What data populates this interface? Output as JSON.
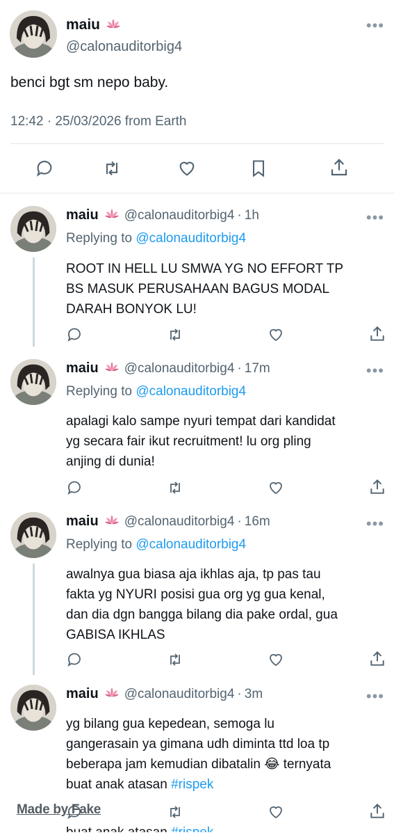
{
  "main_tweet": {
    "display_name": "maiu",
    "handle": "@calonauditorbig4",
    "text": "benci bgt sm nepo baby.",
    "timestamp": "12:42 · 25/03/2026 from Earth",
    "more_icon": "more-icon",
    "actions": [
      "reply-icon",
      "retweet-icon",
      "like-icon",
      "bookmark-icon",
      "share-icon"
    ]
  },
  "replies": [
    {
      "display_name": "maiu",
      "handle": "@calonauditorbig4",
      "separator": "·",
      "time": "1h",
      "replying_prefix": "Replying to",
      "replying_handle": "@calonauditorbig4",
      "lines": [
        "ROOT IN HELL LU SMWA YG NO EFFORT TP",
        "BS MASUK PERUSAHAAN BAGUS MODAL",
        "DARAH BONYOK LU!"
      ]
    },
    {
      "display_name": "maiu",
      "handle": "@calonauditorbig4",
      "separator": "·",
      "time": "17m",
      "replying_prefix": "Replying to",
      "replying_handle": "@calonauditorbig4",
      "lines": [
        "apalagi kalo sampe nyuri tempat dari kandidat",
        "yg secara fair ikut recruitment! lu org pling",
        "anjing di dunia!"
      ]
    },
    {
      "display_name": "maiu",
      "handle": "@calonauditorbig4",
      "separator": "·",
      "time": "16m",
      "replying_prefix": "Replying to",
      "replying_handle": "@calonauditorbig4",
      "lines": [
        "awalnya gua biasa aja ikhlas aja, tp pas tau",
        "fakta yg NYURI posisi gua org yg gua kenal,",
        "dan dia dgn bangga bilang dia pake ordal, gua",
        "GABISA IKHLAS"
      ]
    },
    {
      "display_name": "maiu",
      "handle": "@calonauditorbig4",
      "separator": "·",
      "time": "3m",
      "lines": [
        "yg bilang gua kepedean, semoga lu",
        "gangerasain ya gimana udh diminta ttd loa tp",
        "beberapa jam kemudian dibatalin",
        "buat anak atasan"
      ],
      "emoji": "😂",
      "line3_suffix": "ternyata",
      "hashtag": "#rispek"
    }
  ],
  "watermark": "Made by Fake",
  "ghost_text": "buat anak atasan",
  "ghost_hashtag": "#rispek",
  "colors": {
    "text": "#0f1419",
    "secondary": "#536471",
    "link": "#1d9bf0",
    "divider": "#e1e6ea",
    "thread_line": "#cfd9de"
  }
}
